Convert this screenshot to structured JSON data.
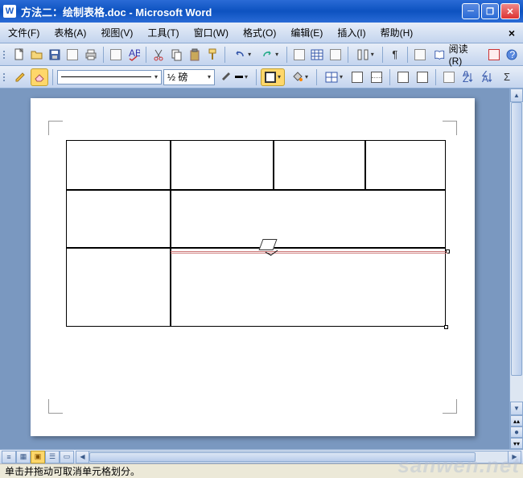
{
  "window": {
    "title": "方法二：绘制表格.doc - Microsoft Word",
    "app_initial": "W"
  },
  "menu": {
    "file": "文件(F)",
    "table": "表格(A)",
    "view": "视图(V)",
    "tools": "工具(T)",
    "window": "窗口(W)",
    "format": "格式(O)",
    "edit": "编辑(E)",
    "insert": "插入(I)",
    "help": "帮助(H)",
    "close": "×"
  },
  "toolbar1": {
    "read_label": "阅读(R)"
  },
  "toolbar2": {
    "line_weight": "½ 磅",
    "weight_suffix": "▾"
  },
  "status": {
    "text": "单击并拖动可取消单元格划分。"
  },
  "watermark": "sanwen.net",
  "icons": {
    "new": "new-icon",
    "open": "open-icon",
    "save": "save-icon",
    "draw_table": "draw-table-icon",
    "eraser": "eraser-icon"
  }
}
